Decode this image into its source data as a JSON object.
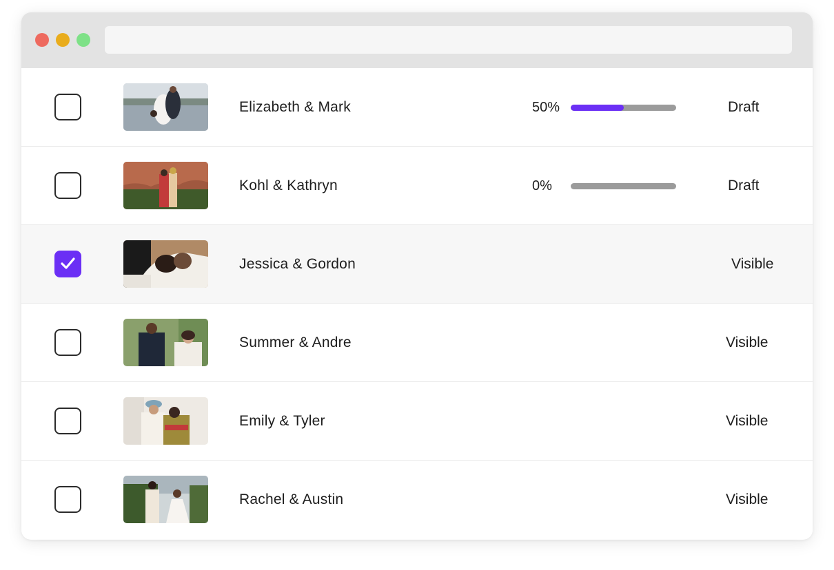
{
  "browser": {
    "address_value": ""
  },
  "accent_color": "#6b2ff5",
  "galleries": [
    {
      "name": "Elizabeth & Mark",
      "progress_label": "50%",
      "progress": 0.5,
      "status": "Draft",
      "selected": false
    },
    {
      "name": "Kohl & Kathryn",
      "progress_label": "0%",
      "progress": 0,
      "status": "Draft",
      "selected": false
    },
    {
      "name": "Jessica & Gordon",
      "status": "Visible",
      "selected": true
    },
    {
      "name": "Summer & Andre",
      "status": "Visible",
      "selected": false
    },
    {
      "name": "Emily & Tyler",
      "status": "Visible",
      "selected": false
    },
    {
      "name": "Rachel & Austin",
      "status": "Visible",
      "selected": false
    }
  ]
}
